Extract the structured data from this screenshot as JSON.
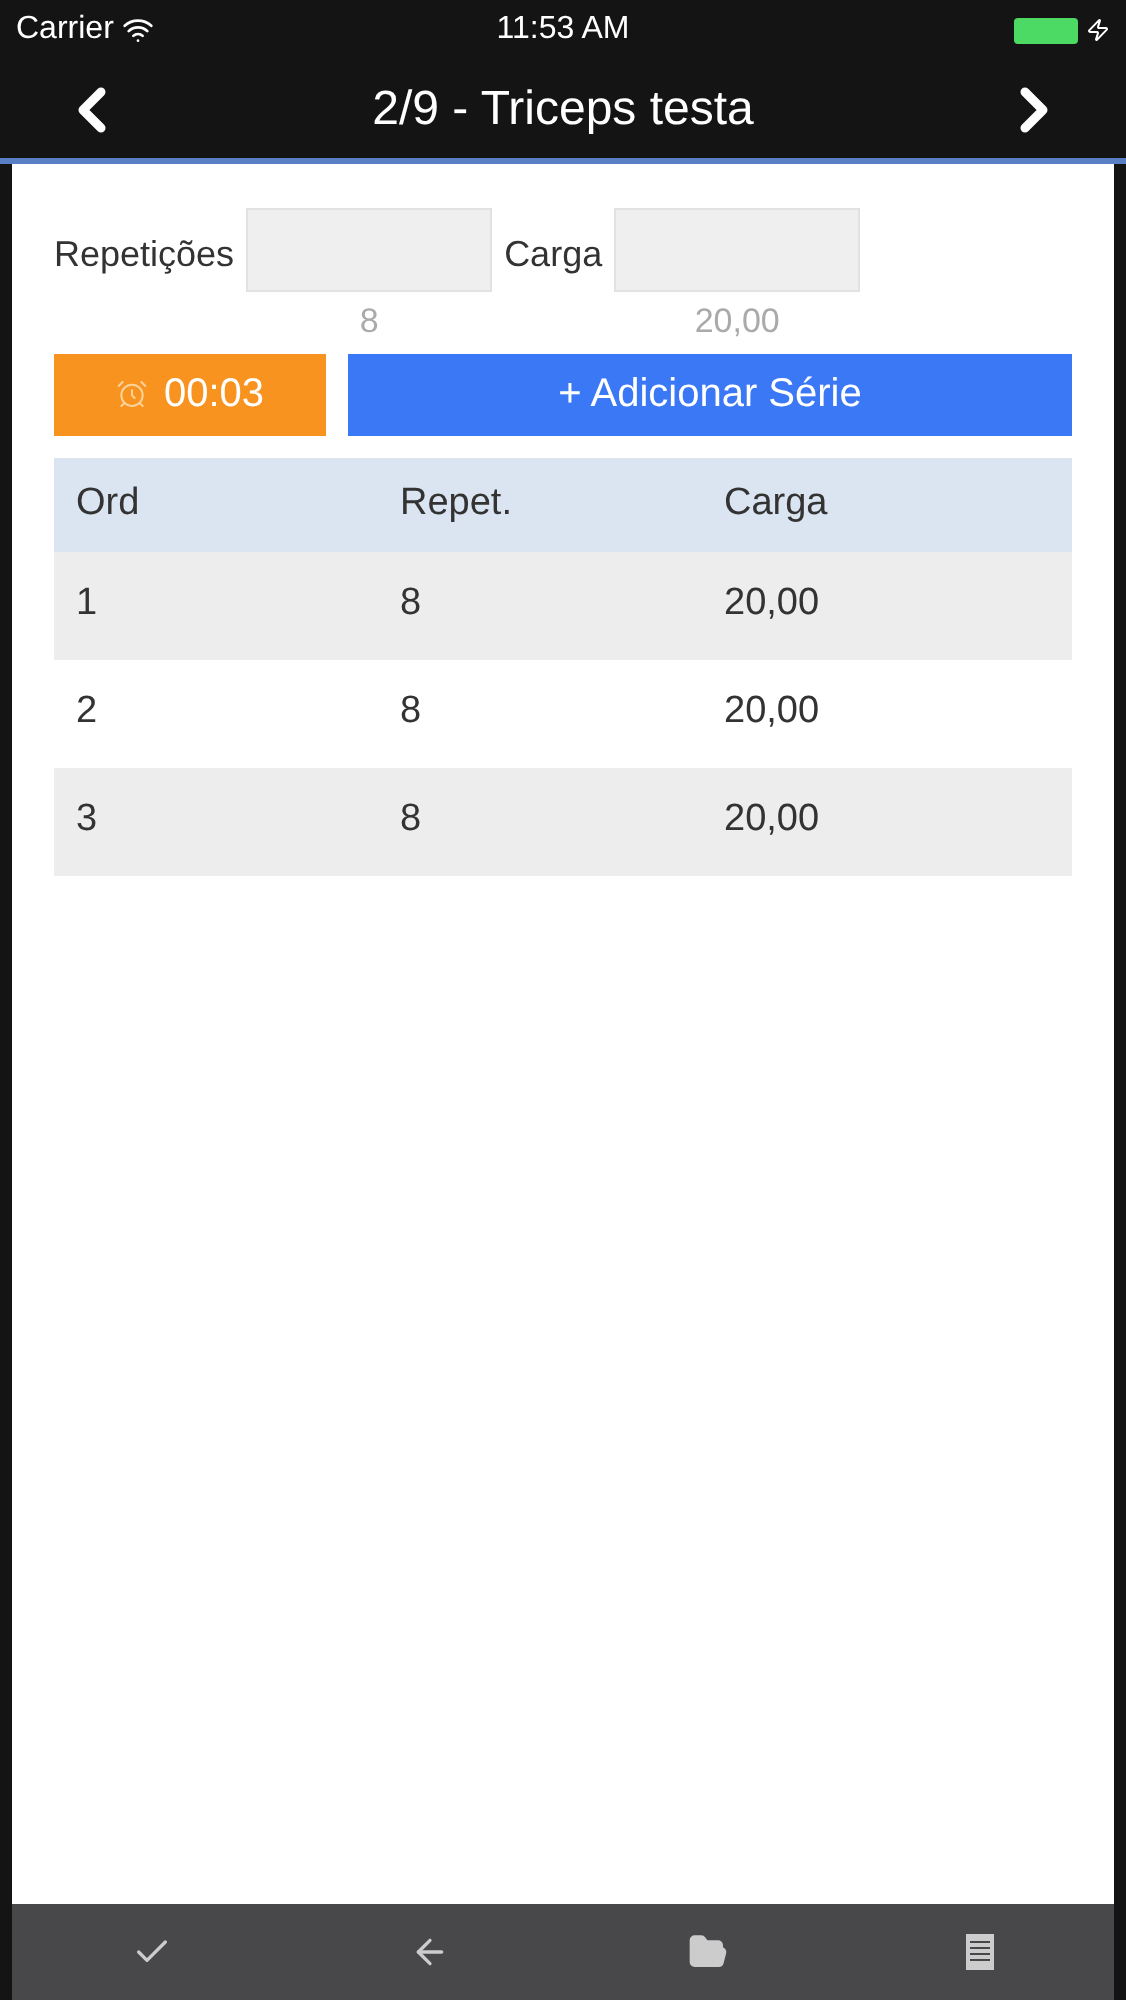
{
  "status_bar": {
    "carrier": "Carrier",
    "time": "11:53 AM"
  },
  "nav": {
    "title": "2/9 - Triceps testa"
  },
  "fields": [
    {
      "label": "Repetições",
      "hint": "8"
    },
    {
      "label": "Carga",
      "hint": "20,00"
    }
  ],
  "timer": {
    "label": "00:03"
  },
  "add_button": {
    "label": "+ Adicionar Série"
  },
  "table": {
    "columns": [
      "Ord",
      "Repet.",
      "Carga"
    ],
    "rows": [
      [
        "1",
        "8",
        "20,00"
      ],
      [
        "2",
        "8",
        "20,00"
      ],
      [
        "3",
        "8",
        "20,00"
      ]
    ]
  }
}
